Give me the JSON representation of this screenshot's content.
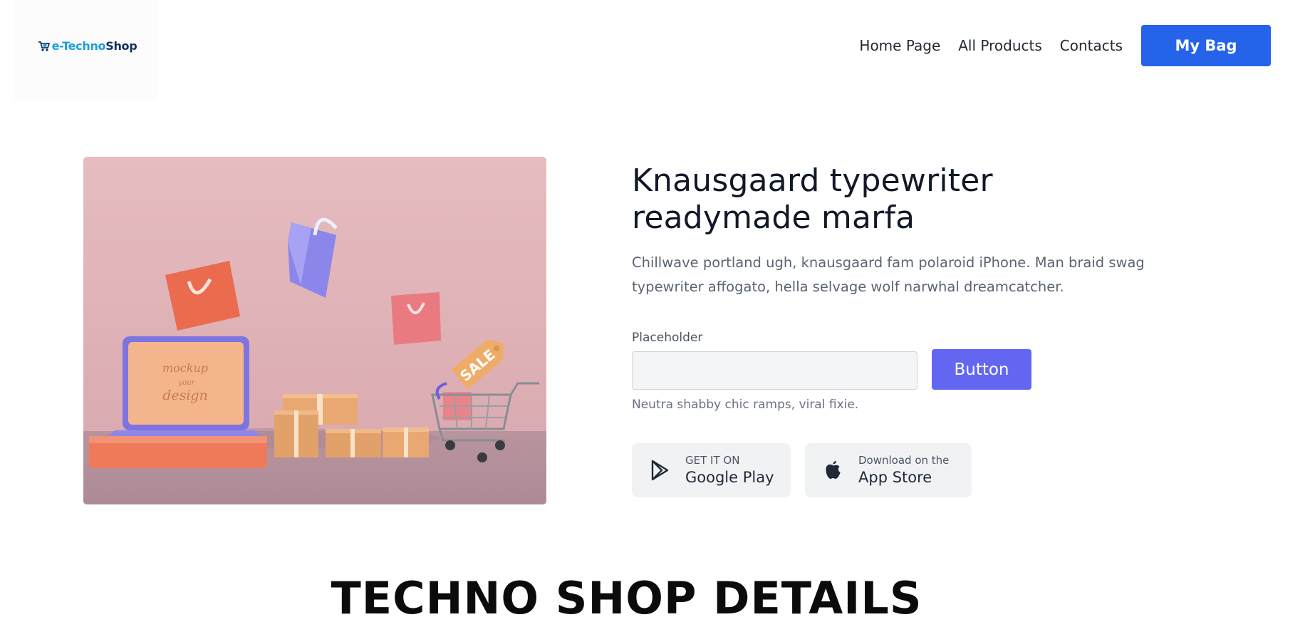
{
  "header": {
    "logo": {
      "part1": "e-Techno",
      "part2": "Shop"
    },
    "nav": [
      {
        "label": "Home Page"
      },
      {
        "label": "All Products"
      },
      {
        "label": "Contacts"
      }
    ],
    "bag_label": "My Bag"
  },
  "hero": {
    "image": {
      "screen_text": [
        "mockup",
        "your",
        "design"
      ],
      "tag_text": "SALE"
    },
    "title": "Knausgaard typewriter readymade marfa",
    "description": "Chillwave portland ugh, knausgaard fam polaroid iPhone. Man braid swag typewriter affogato, hella selvage wolf narwhal dreamcatcher.",
    "input": {
      "label": "Placeholder",
      "value": "",
      "placeholder": ""
    },
    "button_label": "Button",
    "hint": "Neutra shabby chic ramps, viral fixie.",
    "stores": [
      {
        "small": "GET IT ON",
        "big": "Google Play",
        "icon": "google-play-icon"
      },
      {
        "small": "Download on the",
        "big": "App Store",
        "icon": "apple-icon"
      }
    ]
  },
  "section_title": "TECHNO SHOP DETAILS",
  "colors": {
    "primary_blue": "#2563eb",
    "indigo": "#6366f1",
    "hero_bg": "#e0b4b8"
  }
}
